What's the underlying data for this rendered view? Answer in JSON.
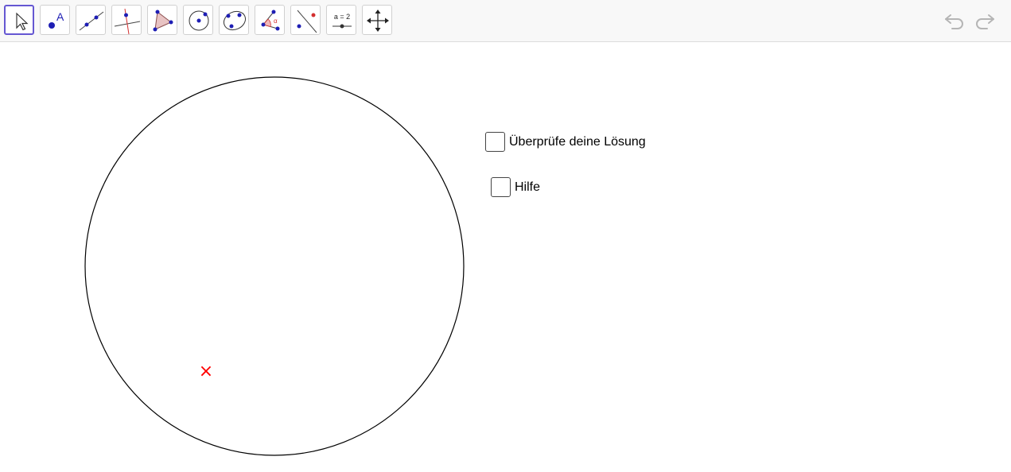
{
  "toolbar": {
    "tools": [
      {
        "name": "move-tool"
      },
      {
        "name": "point-tool",
        "label": "A"
      },
      {
        "name": "line-tool"
      },
      {
        "name": "perpendicular-line-tool"
      },
      {
        "name": "polygon-tool"
      },
      {
        "name": "circle-center-point-tool"
      },
      {
        "name": "conic-tool"
      },
      {
        "name": "angle-tool",
        "label": "α"
      },
      {
        "name": "reflect-tool"
      },
      {
        "name": "slider-tool",
        "label": "a = 2"
      },
      {
        "name": "move-graphics-view-tool"
      }
    ],
    "undo_icon": "undo-icon",
    "redo_icon": "redo-icon"
  },
  "checkboxes": [
    {
      "label": "Überprüfe deine Lösung",
      "checked": false
    },
    {
      "label": "Hilfe",
      "checked": false
    }
  ],
  "canvas": {
    "marker_symbol": "×",
    "colors": {
      "circle": "#000000",
      "marker": "#ff0000",
      "point": "#1e1eb4",
      "selected_border": "#6557d2"
    }
  }
}
